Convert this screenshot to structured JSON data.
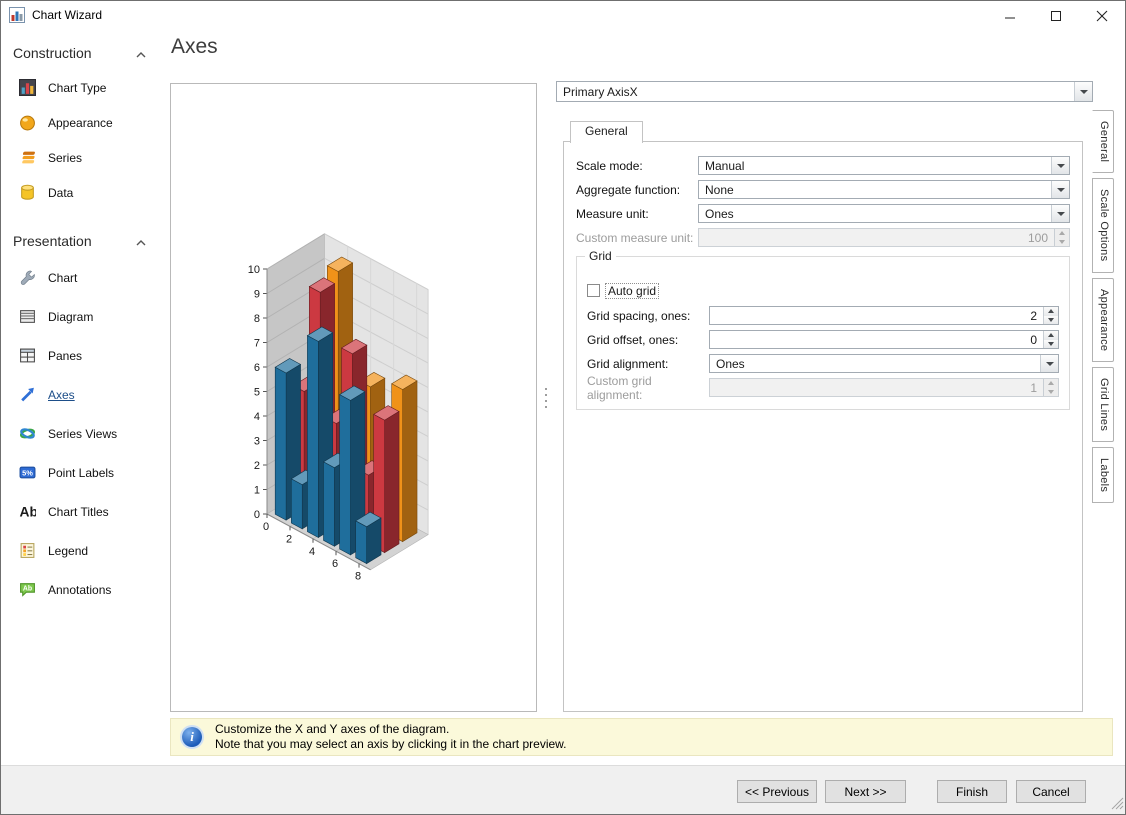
{
  "titlebar": {
    "title": "Chart Wizard"
  },
  "page": {
    "title": "Axes"
  },
  "sidebar": {
    "groups": [
      {
        "title": "Construction",
        "items": [
          {
            "label": "Chart Type",
            "icon": "chart-type-icon"
          },
          {
            "label": "Appearance",
            "icon": "sphere-icon"
          },
          {
            "label": "Series",
            "icon": "series-icon"
          },
          {
            "label": "Data",
            "icon": "database-icon"
          }
        ]
      },
      {
        "title": "Presentation",
        "items": [
          {
            "label": "Chart",
            "icon": "wrench-icon"
          },
          {
            "label": "Diagram",
            "icon": "diagram-icon"
          },
          {
            "label": "Panes",
            "icon": "panes-icon"
          },
          {
            "label": "Axes",
            "icon": "axes-icon",
            "selected": true
          },
          {
            "label": "Series Views",
            "icon": "series-views-icon"
          },
          {
            "label": "Point Labels",
            "icon": "point-labels-icon"
          },
          {
            "label": "Chart Titles",
            "icon": "chart-titles-icon"
          },
          {
            "label": "Legend",
            "icon": "legend-icon"
          },
          {
            "label": "Annotations",
            "icon": "annotation-icon"
          }
        ]
      }
    ]
  },
  "form": {
    "axis_selector": "Primary AxisX",
    "top_tab": "General",
    "side_tabs": [
      "General",
      "Scale Options",
      "Appearance",
      "Grid Lines",
      "Labels"
    ],
    "rows": {
      "scale_mode": {
        "label": "Scale mode:",
        "value": "Manual"
      },
      "aggregate_function": {
        "label": "Aggregate function:",
        "value": "None"
      },
      "measure_unit": {
        "label": "Measure unit:",
        "value": "Ones"
      },
      "custom_measure_unit": {
        "label": "Custom measure unit:",
        "value": "100",
        "disabled": true
      }
    },
    "grid": {
      "title": "Grid",
      "auto_grid_label": "Auto grid",
      "auto_grid_checked": false,
      "grid_spacing": {
        "label": "Grid spacing, ones:",
        "value": "2"
      },
      "grid_offset": {
        "label": "Grid offset, ones:",
        "value": "0"
      },
      "grid_alignment": {
        "label": "Grid alignment:",
        "value": "Ones"
      },
      "custom_grid_alignment": {
        "label": "Custom grid alignment:",
        "value": "1",
        "disabled": true
      }
    }
  },
  "info_bar": {
    "line1": "Customize the X and Y axes of the diagram.",
    "line2": "Note that you may select an axis by clicking it in the chart preview."
  },
  "footer": {
    "previous": "<< Previous",
    "next": "Next >>",
    "finish": "Finish",
    "cancel": "Cancel"
  },
  "chart_data": {
    "type": "bar",
    "style": "3d-manhattan",
    "title": "",
    "xlabel": "",
    "ylabel": "",
    "ylim": [
      0,
      10
    ],
    "y_ticks": [
      0,
      1,
      2,
      3,
      4,
      5,
      6,
      7,
      8,
      9,
      10
    ],
    "x_ticks": [
      0,
      2,
      4,
      6,
      8
    ],
    "bar_x": [
      0.4,
      1.8,
      3.2,
      4.6,
      6.0,
      7.4
    ],
    "series": [
      {
        "name": "blue-series",
        "color": "#1f6e9c",
        "depth": 0,
        "values": [
          6,
          1.8,
          8,
          3.2,
          6.3,
          1.5
        ]
      },
      {
        "name": "red-series",
        "color": "#cc3941",
        "depth": 1,
        "values": [
          4.8,
          9.2,
          4.2,
          7.4,
          2.8,
          5.4
        ]
      },
      {
        "name": "orange-series",
        "color": "#f09219",
        "depth": 2,
        "values": [
          6.8,
          9.6,
          2.8,
          5.6,
          4.2,
          6.2
        ]
      }
    ]
  }
}
